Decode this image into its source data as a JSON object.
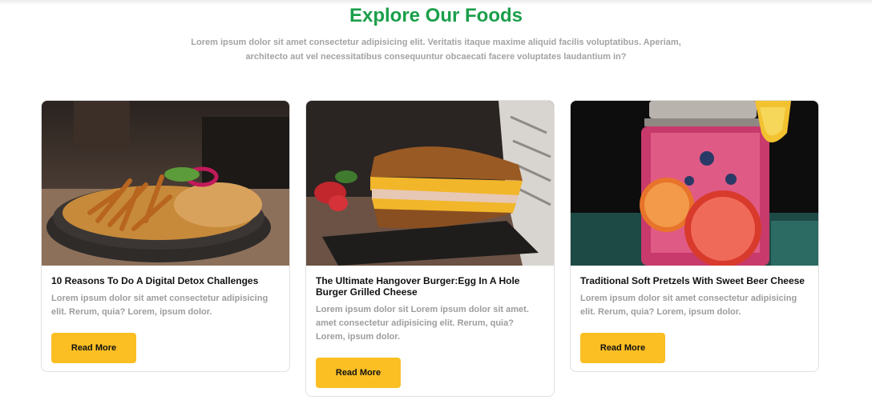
{
  "section": {
    "title": "Explore Our Foods",
    "subtitle_line1": "Lorem ipsum dolor sit amet consectetur adipisicing elit. Veritatis itaque maxime aliquid facilis voluptatibus. Aperiam,",
    "subtitle_line2": "architecto aut vel necessitatibus consequuntur obcaecati facere voluptates laudantium in?"
  },
  "colors": {
    "accent_green": "#1a9f4a",
    "button_yellow": "#fbbf24",
    "muted_text": "#9d9d9d"
  },
  "cards": [
    {
      "image": "fries-and-onion-rings-basket-image",
      "title": "10 Reasons To Do A Digital Detox Challenges",
      "desc_line1": "Lorem ipsum dolor sit amet consectetur adipisicing",
      "desc_line2": "elit. Rerum, quia? Lorem, ipsum dolor.",
      "button": "Read More"
    },
    {
      "image": "grilled-cheese-sandwich-image",
      "title_line1": "The Ultimate Hangover Burger:Egg In A Hole",
      "title_line2": "Burger Grilled Cheese",
      "desc_line1": "Lorem ipsum dolor sit Lorem ipsum dolor sit amet.",
      "desc_line2": "amet consectetur adipisicing elit. Rerum, quia?",
      "desc_line3": "Lorem, ipsum dolor.",
      "button": "Read More"
    },
    {
      "image": "pink-lemonade-jar-image",
      "title": "Traditional Soft Pretzels With Sweet Beer Cheese",
      "desc_line1": "Lorem ipsum dolor sit amet consectetur adipisicing",
      "desc_line2": "elit. Rerum, quia? Lorem, ipsum dolor.",
      "button": "Read More"
    }
  ]
}
